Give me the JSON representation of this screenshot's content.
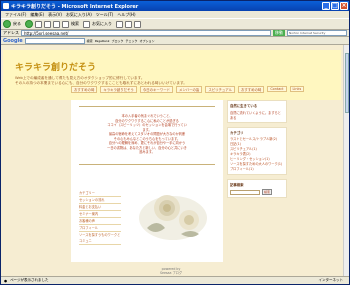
{
  "window": {
    "title": "キラキラ創りだそう - Microsoft Internet Explorer"
  },
  "menu": [
    "ファイル(F)",
    "編集(E)",
    "表示(V)",
    "お気に入り(A)",
    "ツール(T)",
    "ヘルプ(H)"
  ],
  "toolbar": {
    "back": "戻る",
    "search": "検索",
    "favorites": "お気に入り"
  },
  "address": {
    "label": "アドレス",
    "value": "http://5xrl.seesaa.net/",
    "go": "移動",
    "links": "Norton Internet Security"
  },
  "googlebar": {
    "brand": "Google",
    "items": [
      "検索",
      "PageRank",
      "ブロック",
      "チェック",
      "オプション"
    ]
  },
  "page": {
    "title": "キラキラ創りだそう",
    "desc1": "Web上での編成者を通して得たも見え方のオタクショップ的に修行しています。",
    "desc2": "その人の持つの本業までいる心にも、自分のワクワクするこことも取れずにあとわれる時いいけています。",
    "nav": [
      "おすすめの時",
      "キラキラ創りだそう",
      "今日のキーワード",
      "メンバーの皆",
      "スピリチュアル",
      "おすすめの時",
      "Contact",
      "Links"
    ],
    "intro": [
      "本の入手者の気まぐれでいうこと、",
      "自分のワクワクするこ心に私のことが過ぎる",
      "ココイ（スピーリッツ）のセッションを会場で行っています。",
      "",
      "最高の宿命を考えてスタジオの問題が大きなのか判断",
      "その心もみんなとこのうち心をもっています。",
      "自分への理解を深め、更にそれが自分や一手に向かう",
      "一日の書物は、あなた方と新しい、自分の心と共にいき進みます。"
    ],
    "left_links": [
      "カテゴリー",
      "セッションの流れ",
      "料金とお支払い",
      "セミナー案内",
      "お客様の声",
      "プロフィール",
      "ソースを探すうものワークとコミュニ"
    ],
    "sidebar": {
      "profile_title": "自然に生きている",
      "profile_text": "自然に流れていくように。ますらとある",
      "category_title": "カテゴリ",
      "categories": [
        "ラストとセールス/トラブル新(2)",
        "日記(1)",
        "スピリチュアル(1)",
        "キラキラ表(2)",
        "ヒーリング・セッション(1)",
        "ソースを探すための大人のワーク(1)",
        "プロフィール(1)"
      ],
      "search_title": "記事検索",
      "search_button": "検索"
    },
    "footer1": "powered by",
    "footer2": "Seesaa ブログ"
  },
  "status": {
    "left": "ページが表示されました",
    "right": "インターネット"
  }
}
